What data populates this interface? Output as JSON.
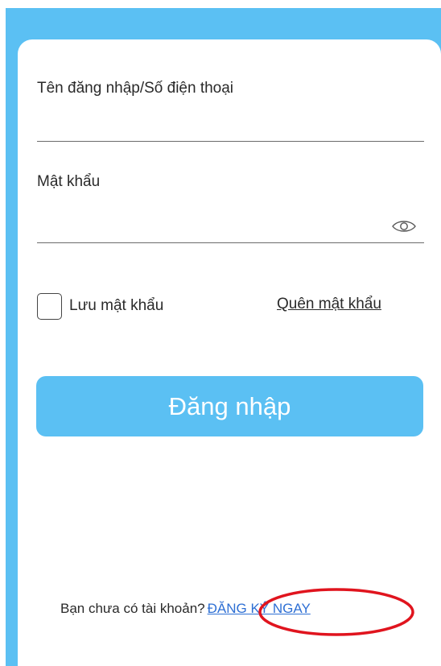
{
  "colors": {
    "accent": "#5bc0f3",
    "link": "#2e6fd4",
    "highlight": "#e0141e",
    "text": "#2a2a2a"
  },
  "login_form": {
    "username": {
      "label": "Tên đăng nhập/Số điện thoại",
      "value": ""
    },
    "password": {
      "label": "Mật khẩu",
      "value": "",
      "toggle_icon": "eye-icon"
    },
    "remember": {
      "label": "Lưu mật khẩu",
      "checked": false
    },
    "forgot_label": "Quên mật khẩu",
    "submit_label": "Đăng nhập"
  },
  "footer": {
    "prompt": "Bạn chưa có tài khoản?",
    "register_label": "ĐĂNG KÝ NGAY"
  }
}
